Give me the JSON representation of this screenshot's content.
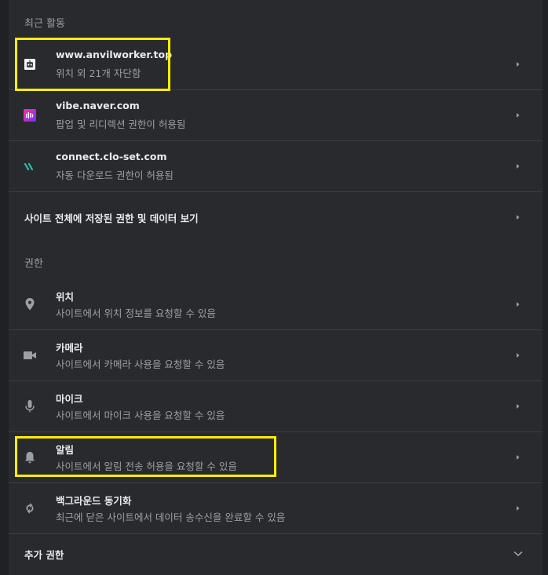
{
  "recent_activity": {
    "heading": "최근 활동",
    "items": [
      {
        "title": "www.anvilworker.top",
        "sub": "위치 외 21개 자단함",
        "icon": "robot-favicon-icon"
      },
      {
        "title": "vibe.naver.com",
        "sub": "팝업 및 리디렉션 권한이 허용됨",
        "icon": "vibe-favicon-icon"
      },
      {
        "title": "connect.clo-set.com",
        "sub": "자동 다운로드 권한이 허용됨",
        "icon": "clo-favicon-icon"
      }
    ],
    "view_all": "사이트 전체에 저장된 권한 및 데이터 보기"
  },
  "permissions": {
    "heading": "권한",
    "items": [
      {
        "title": "위치",
        "sub": "사이트에서 위치 정보를 요청할 수 있음",
        "icon": "location-pin-icon"
      },
      {
        "title": "카메라",
        "sub": "사이트에서 카메라 사용을 요청할 수 있음",
        "icon": "camera-icon"
      },
      {
        "title": "마이크",
        "sub": "사이트에서 마이크 사용을 요청할 수 있음",
        "icon": "microphone-icon"
      },
      {
        "title": "알림",
        "sub": "사이트에서 알림 전송 허용을 요청할 수 있음",
        "icon": "bell-icon"
      },
      {
        "title": "백그라운드 동기화",
        "sub": "최근에 닫은 사이트에서 데이터 송수신을 완료할 수 있음",
        "icon": "sync-icon"
      }
    ],
    "more": "추가 권한"
  },
  "colors": {
    "background": "#202124",
    "card": "#292a2d",
    "highlight": "#ffee00"
  }
}
